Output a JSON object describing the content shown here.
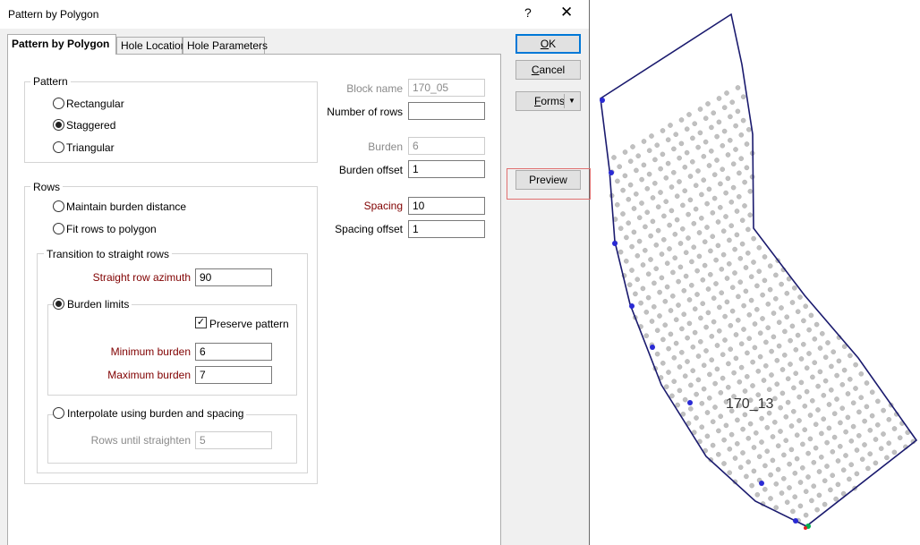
{
  "dialog": {
    "title": "Pattern by Polygon",
    "help_glyph": "?",
    "close_glyph": "✕"
  },
  "tabs": [
    {
      "label": "Pattern by Polygon",
      "active": true
    },
    {
      "label": "Hole Location",
      "active": false
    },
    {
      "label": "Hole Parameters",
      "active": false
    }
  ],
  "pattern": {
    "group_label": "Pattern",
    "options": [
      {
        "label": "Rectangular",
        "checked": false
      },
      {
        "label": "Staggered",
        "checked": true
      },
      {
        "label": "Triangular",
        "checked": false
      }
    ]
  },
  "rows": {
    "group_label": "Rows",
    "options": [
      {
        "label": "Maintain burden distance",
        "checked": false
      },
      {
        "label": "Fit rows to polygon",
        "checked": false
      }
    ],
    "transition": {
      "group_label": "Transition to straight rows",
      "azimuth_label": "Straight row azimuth",
      "azimuth_value": "90",
      "burden_limits": {
        "label": "Burden limits",
        "checked": true,
        "preserve_label": "Preserve pattern",
        "preserve_checked": true,
        "min_label": "Minimum burden",
        "min_value": "6",
        "max_label": "Maximum burden",
        "max_value": "7"
      },
      "interpolate": {
        "label": "Interpolate using burden and spacing",
        "checked": false,
        "rows_label": "Rows until straighten",
        "rows_value": "5"
      }
    }
  },
  "fields": {
    "block_name_label": "Block name",
    "block_name_value": "170_05",
    "num_rows_label": "Number of rows",
    "num_rows_value": "",
    "burden_label": "Burden",
    "burden_value": "6",
    "burden_offset_label": "Burden offset",
    "burden_offset_value": "1",
    "spacing_label": "Spacing",
    "spacing_value": "10",
    "spacing_offset_label": "Spacing offset",
    "spacing_offset_value": "1"
  },
  "buttons": {
    "ok_mnemonic": "O",
    "ok_rest": "K",
    "cancel_mnemonic": "C",
    "cancel_rest": "ancel",
    "forms_mnemonic": "F",
    "forms_rest": "orms",
    "preview": "Preview",
    "dropdown_glyph": "▼"
  },
  "preview": {
    "block_label": "170_13",
    "colors": {
      "outline": "#1a1a6e",
      "hole_fill": "#c0c0c0",
      "hole_stroke": "#a8a8a8",
      "edge_vertex": "#2a2ad4",
      "start_marker": "#00b050",
      "end_marker": "#e02020"
    }
  }
}
